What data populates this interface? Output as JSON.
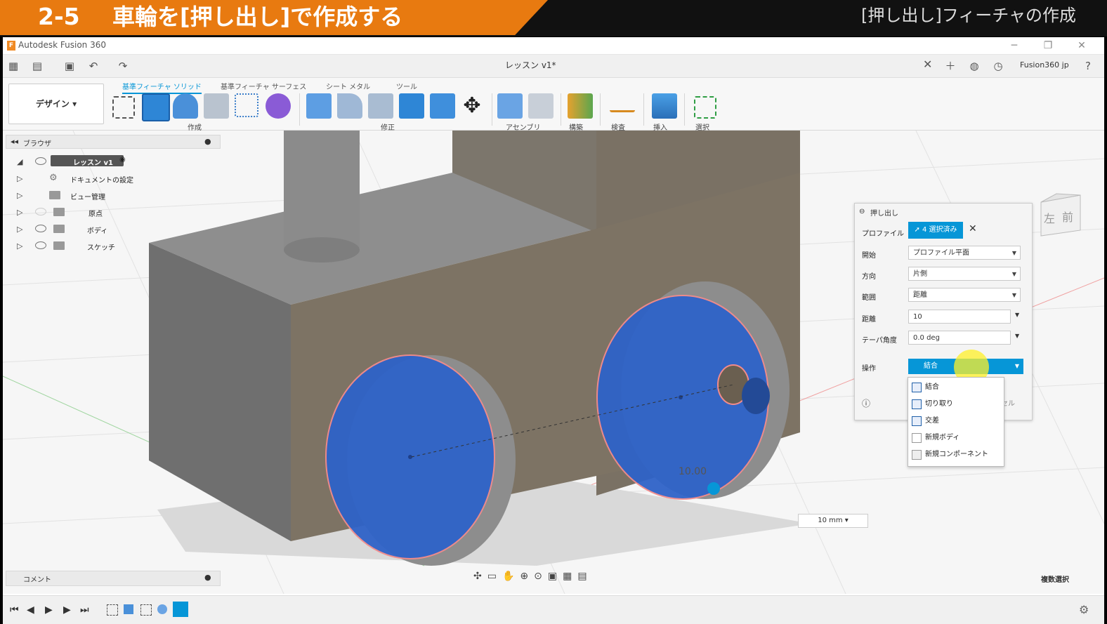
{
  "banner": {
    "number": "2-5",
    "title": "車輪を[押し出し]で作成する",
    "subtitle": "[押し出し]フィーチャの作成"
  },
  "window": {
    "app_title": "Autodesk Fusion 360",
    "doc_tab": "レッスン v1*",
    "account": "Fusion360 jp"
  },
  "ribbon": {
    "workspace": "デザイン",
    "tabs": [
      "基準フィーチャ ソリッド",
      "基準フィーチャ サーフェス",
      "シート メタル",
      "ツール"
    ],
    "groups": [
      "作成",
      "修正",
      "アセンブリ",
      "構築",
      "検査",
      "挿入",
      "選択"
    ]
  },
  "browser": {
    "title": "ブラウザ",
    "root": "レッスン v1",
    "items": [
      "ドキュメントの設定",
      "ビュー管理",
      "原点",
      "ボディ",
      "スケッチ"
    ]
  },
  "comment": "コメント",
  "extrude": {
    "title": "押し出し",
    "profile_label": "プロファイル",
    "profile_value": "4 選択済み",
    "start_label": "開始",
    "start_value": "プロファイル平面",
    "direction_label": "方向",
    "direction_value": "片側",
    "extent_label": "範囲",
    "extent_value": "距離",
    "distance_label": "距離",
    "distance_value": "10",
    "taper_label": "テーパ角度",
    "taper_value": "0.0 deg",
    "operation_label": "操作",
    "operation_value": "結合",
    "cancel_partial": "セル",
    "operation_options": [
      "結合",
      "切り取り",
      "交差",
      "新規ボディ",
      "新規コンポーネント"
    ]
  },
  "viewport": {
    "dimension_label": "10.00",
    "dimension_input": "10 mm",
    "viewcube_left": "左",
    "viewcube_front": "前"
  },
  "statusbar": {
    "multi_select": "複数選択"
  },
  "colors": {
    "accent": "#0696d7",
    "banner": "#e87a10",
    "body": "#7d7364",
    "wheel": "#2f63c8"
  }
}
